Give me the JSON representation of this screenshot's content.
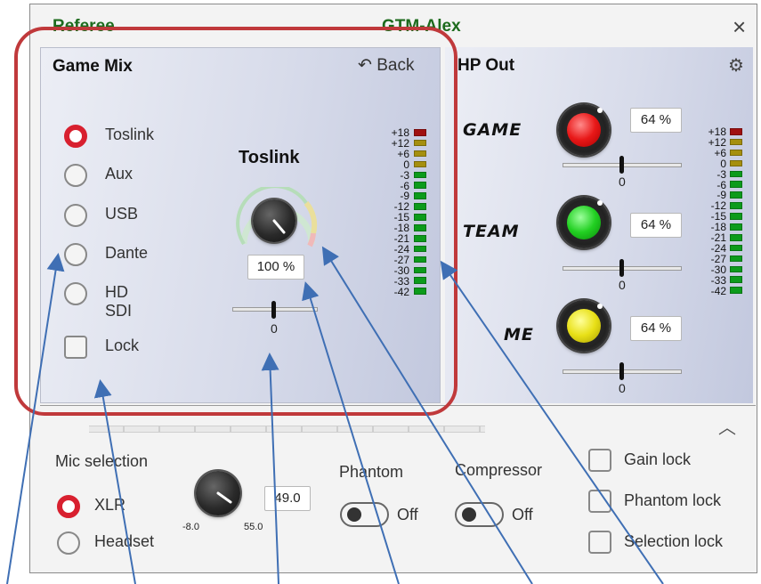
{
  "window": {
    "title_left": "Referee",
    "title_center": "GTM-Alex",
    "close_glyph": "×"
  },
  "game_mix": {
    "title": "Game Mix",
    "back_label": "Back",
    "back_icon": "↶",
    "sources": [
      {
        "label": "Toslink",
        "selected": true
      },
      {
        "label": "Aux",
        "selected": false
      },
      {
        "label": "USB",
        "selected": false
      },
      {
        "label": "Dante",
        "selected": false
      },
      {
        "label": "HD SDI",
        "selected": false
      }
    ],
    "lock_label": "Lock",
    "knob_title": "Toslink",
    "volume": "100 %",
    "balance": "0"
  },
  "vu_scale": [
    "+18",
    "+12",
    "+6",
    "0",
    "-3",
    "-6",
    "-9",
    "-12",
    "-15",
    "-18",
    "-21",
    "-24",
    "-27",
    "-30",
    "-33",
    "-42"
  ],
  "vu_colors": {
    "red": "#a01010",
    "yellow": "#a58f0e",
    "green": "#0c9b1b"
  },
  "hp_out": {
    "title": "HP Out",
    "settings_icon": "⚙",
    "channels": [
      {
        "label": "GAME",
        "level": "64 %",
        "balance": "0",
        "color": "#e81818"
      },
      {
        "label": "TEAM",
        "level": "64 %",
        "balance": "0",
        "color": "#22d022"
      },
      {
        "label": "ME",
        "level": "64 %",
        "balance": "0",
        "color": "#e8e017"
      }
    ]
  },
  "bottom": {
    "collapse_icon": "︿",
    "mic_selection_label": "Mic selection",
    "mic_options": [
      {
        "label": "XLR",
        "selected": true
      },
      {
        "label": "Headset",
        "selected": false
      }
    ],
    "gain_value": "49.0",
    "gain_min": "-8.0",
    "gain_max": "55.0",
    "phantom_label": "Phantom",
    "phantom_state": "Off",
    "compressor_label": "Compressor",
    "compressor_state": "Off",
    "locks": [
      "Gain lock",
      "Phantom lock",
      "Selection lock"
    ]
  },
  "accent_color": "#c0393b"
}
